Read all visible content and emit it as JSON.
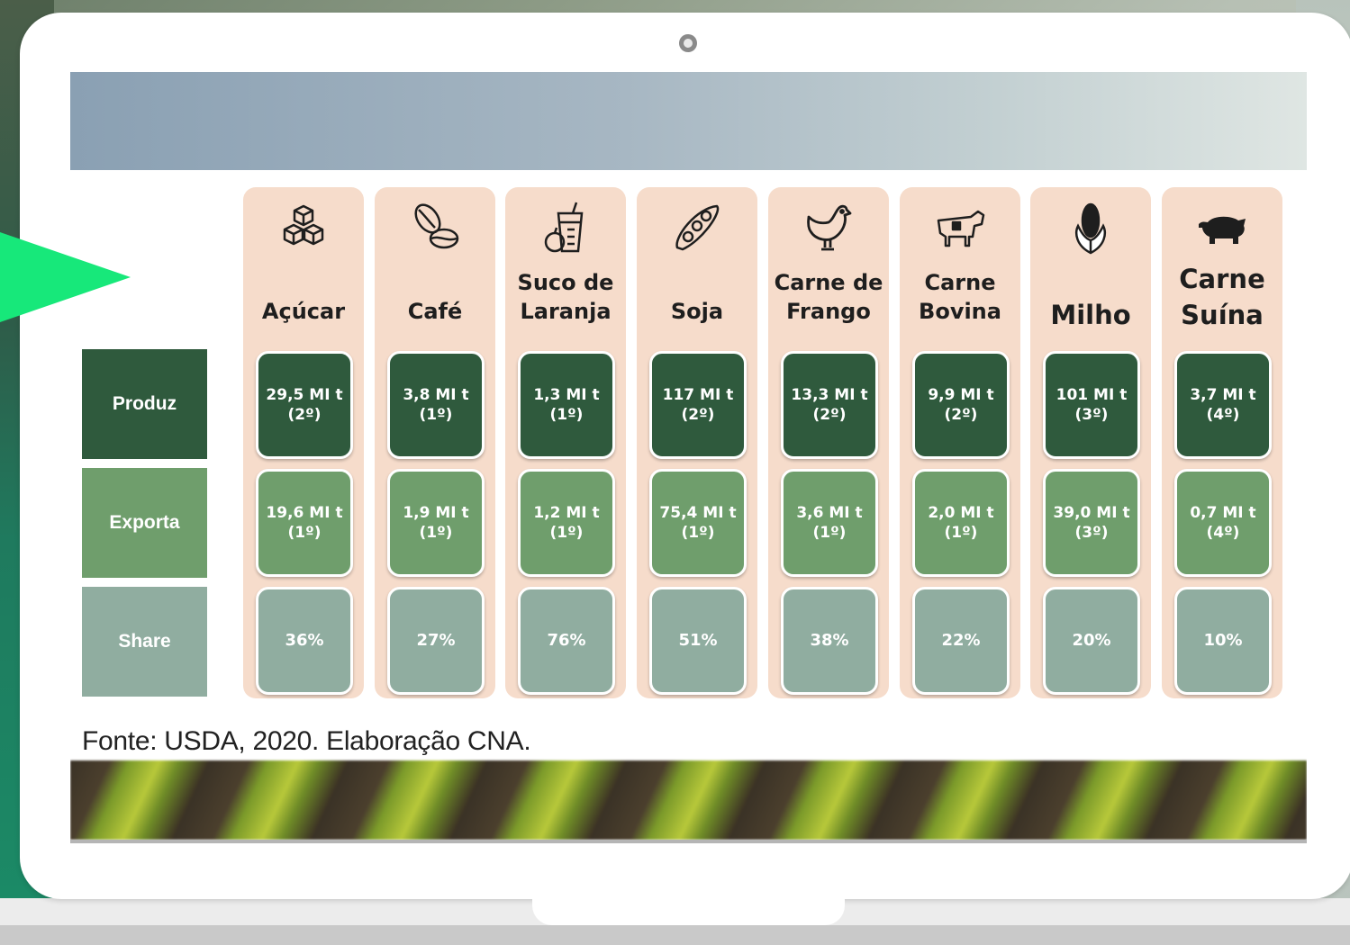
{
  "source": "Fonte: USDA, 2020. Elaboração CNA.",
  "rows": {
    "produz": "Produz",
    "exporta": "Exporta",
    "share": "Share"
  },
  "colors": {
    "produz": "#2f5a3d",
    "exporta": "#6f9e6c",
    "share": "#90ada0",
    "column_bg": "#f6dccb",
    "accent_arrow": "#17e87a"
  },
  "products": [
    {
      "label": "Açúcar",
      "icon": "sugar-cubes-icon",
      "produz": "29,5 MI t\n(2º)",
      "exporta": "19,6 MI t\n(1º)",
      "share": "36%"
    },
    {
      "label": "Café",
      "icon": "coffee-bean-icon",
      "produz": "3,8 MI t\n(1º)",
      "exporta": "1,9 MI t\n(1º)",
      "share": "27%"
    },
    {
      "label": "Suco de\nLaranja",
      "icon": "juice-glass-icon",
      "produz": "1,3 MI t\n(1º)",
      "exporta": "1,2 MI t\n(1º)",
      "share": "76%"
    },
    {
      "label": "Soja",
      "icon": "soybean-pod-icon",
      "produz": "117 MI t\n(2º)",
      "exporta": "75,4 MI t\n(1º)",
      "share": "51%"
    },
    {
      "label": "Carne de\nFrango",
      "icon": "chicken-icon",
      "produz": "13,3 MI t\n(2º)",
      "exporta": "3,6 MI t\n(1º)",
      "share": "38%"
    },
    {
      "label": "Carne\nBovina",
      "icon": "cow-icon",
      "produz": "9,9 MI t\n(2º)",
      "exporta": "2,0 MI t\n(1º)",
      "share": "22%"
    },
    {
      "label": "Milho",
      "icon": "corn-icon",
      "produz": "101 MI t\n(3º)",
      "exporta": "39,0 MI t\n(3º)",
      "share": "20%"
    },
    {
      "label": "Carne\nSuína",
      "icon": "pig-icon",
      "produz": "3,7 MI t\n(4º)",
      "exporta": "0,7 MI t\n(4º)",
      "share": "10%"
    }
  ]
}
